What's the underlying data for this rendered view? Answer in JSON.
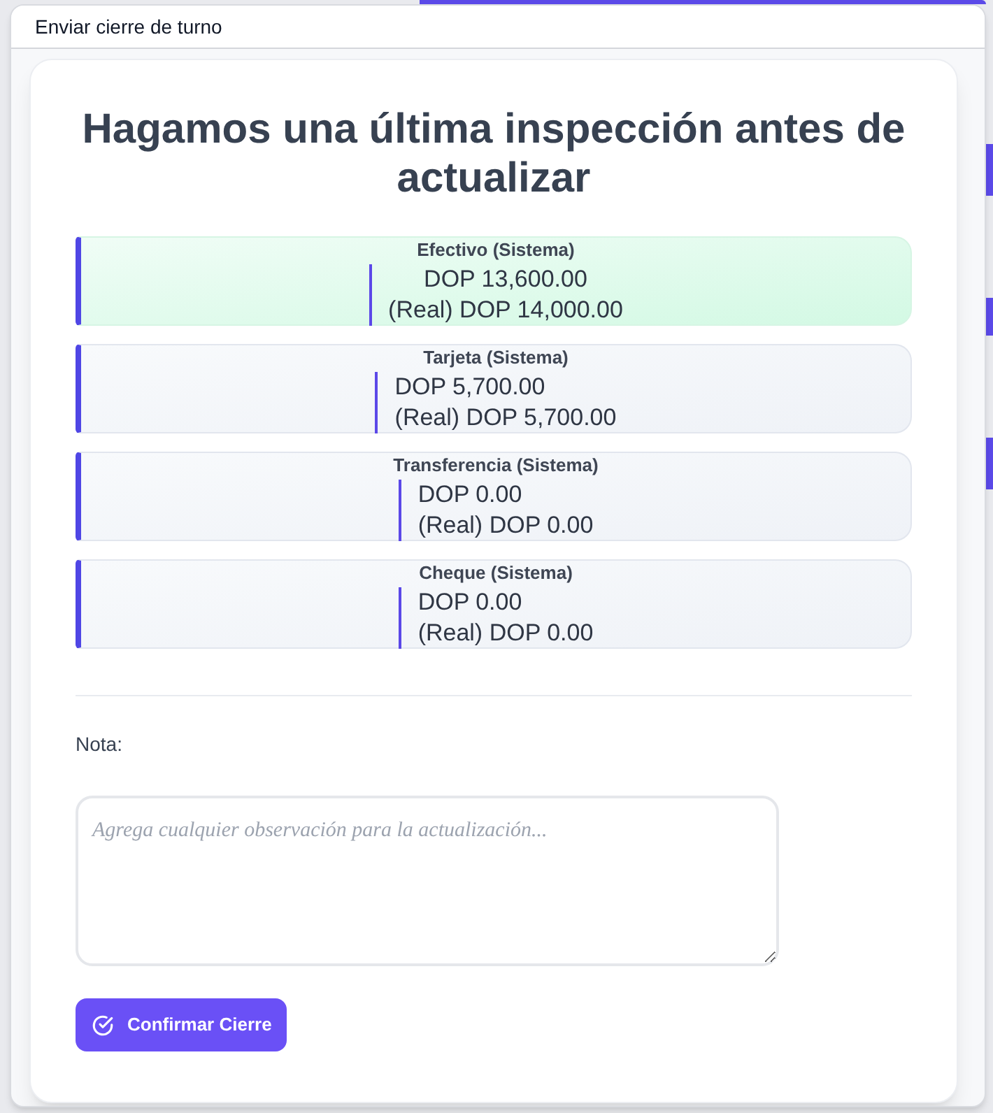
{
  "window": {
    "title": "Enviar cierre de turno"
  },
  "heading": "Hagamos una última inspección antes de actualizar",
  "payments": [
    {
      "label": "Efectivo (Sistema)",
      "system": "DOP 13,600.00",
      "real": "(Real) DOP 14,000.00",
      "highlighted": true
    },
    {
      "label": "Tarjeta (Sistema)",
      "system": "DOP 5,700.00",
      "real": "(Real) DOP 5,700.00",
      "highlighted": false
    },
    {
      "label": "Transferencia (Sistema)",
      "system": "DOP 0.00",
      "real": "(Real) DOP 0.00",
      "highlighted": false
    },
    {
      "label": "Cheque (Sistema)",
      "system": "DOP 0.00",
      "real": "(Real) DOP 0.00",
      "highlighted": false
    }
  ],
  "note": {
    "label": "Nota:",
    "placeholder": "Agrega cualquier observación para la actualización..."
  },
  "confirm_button": {
    "label": "Confirmar Cierre"
  }
}
